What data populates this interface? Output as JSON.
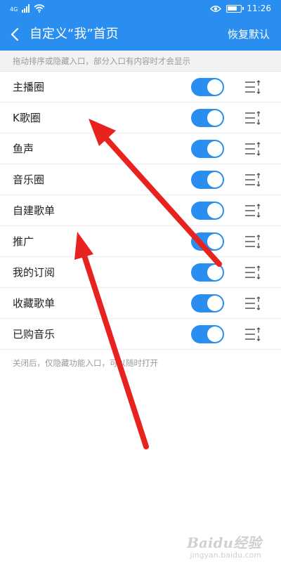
{
  "status_bar": {
    "left_indicator": "4G",
    "time": "11:26"
  },
  "header": {
    "title": "自定义“我”首页",
    "reset_label": "恢复默认"
  },
  "hint": "拖动排序或隐藏入口，部分入口有内容时才会显示",
  "items": [
    {
      "label": "主播圈",
      "enabled": true
    },
    {
      "label": "K歌圈",
      "enabled": true
    },
    {
      "label": "鱼声",
      "enabled": true
    },
    {
      "label": "音乐圈",
      "enabled": true
    },
    {
      "label": "自建歌单",
      "enabled": true
    },
    {
      "label": "推广",
      "enabled": true
    },
    {
      "label": "我的订阅",
      "enabled": true
    },
    {
      "label": "收藏歌单",
      "enabled": true
    },
    {
      "label": "已购音乐",
      "enabled": true
    }
  ],
  "footer_note": "关闭后，仅隐藏功能入口，可以随时打开",
  "watermark": {
    "brand": "Baidu经验",
    "url": "jingyan.baidu.com"
  },
  "colors": {
    "accent": "#2a8ef0",
    "annotation_arrow": "#e8231f"
  }
}
